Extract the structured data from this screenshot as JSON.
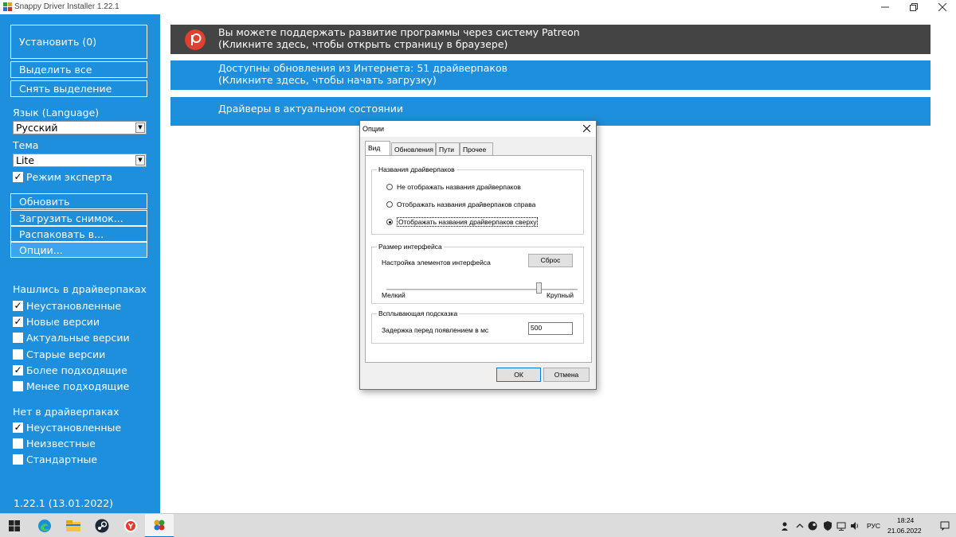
{
  "window": {
    "title": "Snappy Driver Installer 1.22.1"
  },
  "sidebar": {
    "install_label": "Установить (0)",
    "select_all": "Выделить все",
    "deselect": "Снять выделение",
    "language_label": "Язык (Language)",
    "language_value": "Русский",
    "theme_label": "Тема",
    "theme_value": "Lite",
    "expert_mode": "Режим эксперта",
    "refresh": "Обновить",
    "load_snapshot": "Загрузить снимок...",
    "unpack": "Распаковать в...",
    "options": "Опции...",
    "found_header": "Нашлись в драйверпаках",
    "found_items": [
      {
        "label": "Неустановленные",
        "checked": true
      },
      {
        "label": "Новые версии",
        "checked": true
      },
      {
        "label": "Актуальные версии",
        "checked": false
      },
      {
        "label": "Старые версии",
        "checked": false
      },
      {
        "label": "Более подходящие",
        "checked": true
      },
      {
        "label": "Менее подходящие",
        "checked": false
      }
    ],
    "missing_header": "Нет в драйверпаках",
    "missing_items": [
      {
        "label": "Неустановленные",
        "checked": true
      },
      {
        "label": "Неизвестные",
        "checked": false
      },
      {
        "label": "Стандартные",
        "checked": false
      }
    ],
    "version": "1.22.1 (13.01.2022)"
  },
  "banners": {
    "patreon_line1": "Вы можете поддержать развитие программы через систему Patreon",
    "patreon_line2": "(Кликните здесь, чтобы открыть страницу в браузере)",
    "updates_line1": "Доступны обновления из Интернета: 51 драйверпаков",
    "updates_line2": "(Кликните здесь, чтобы начать загрузку)",
    "actual_line1": "Драйверы в актуальном состоянии"
  },
  "dialog": {
    "title": "Опции",
    "tabs": [
      "Вид",
      "Обновления",
      "Пути",
      "Прочее"
    ],
    "group_names": {
      "title": "Названия драйверпаков",
      "options": [
        {
          "label": "Не отображать названия драйверпаков",
          "selected": false
        },
        {
          "label": "Отображать названия драйверпаков справа",
          "selected": false
        },
        {
          "label": "Отображать названия драйверпаков сверху",
          "selected": true
        }
      ]
    },
    "group_size": {
      "title": "Размер интерфейса",
      "setting_label": "Настройка элементов интерфейса",
      "reset_button": "Сброс",
      "min_label": "Мелкий",
      "max_label": "Крупный",
      "slider_value": 0.8
    },
    "group_tooltip": {
      "title": "Всплывающая подсказка",
      "delay_label": "Задержка перед появлением в мс",
      "delay_value": "500"
    },
    "ok": "ОК",
    "cancel": "Отмена"
  },
  "taskbar": {
    "lang": "РУС",
    "time": "18:24",
    "date": "21.06.2022"
  },
  "colors": {
    "accent": "#1d8fdc",
    "patreon_banner": "#444444",
    "patreon_logo": "#e04030"
  }
}
